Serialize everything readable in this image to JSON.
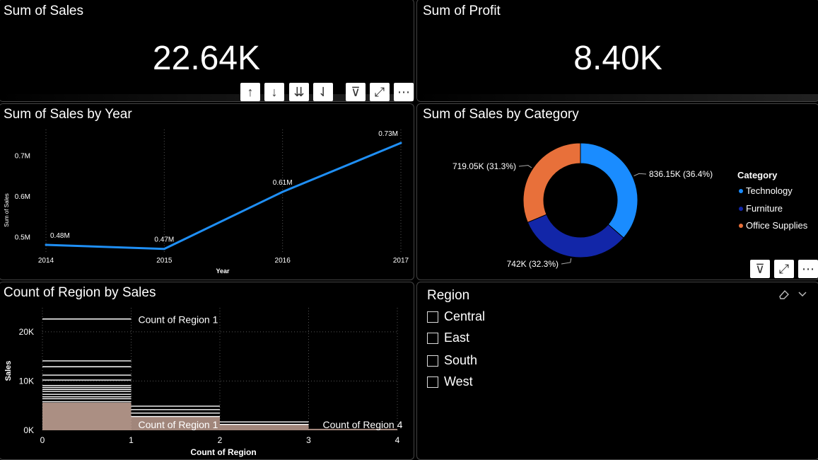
{
  "kpi_sales": {
    "title": "Sum of Sales",
    "value": "22.64K"
  },
  "kpi_profit": {
    "title": "Sum of Profit",
    "value": "8.40K"
  },
  "toolbar": {
    "sort_asc": "↑",
    "sort_desc": "↓",
    "expand_all": "⇊",
    "drill": "⇃",
    "filter": "⊽",
    "focus": "⤢",
    "more": "⋯"
  },
  "line_chart": {
    "title": "Sum of Sales by Year",
    "chart_data": {
      "type": "line",
      "x": [
        2014,
        2015,
        2016,
        2017
      ],
      "values": [
        0.48,
        0.47,
        0.61,
        0.73
      ],
      "data_labels": [
        "0.48M",
        "0.47M",
        "0.61M",
        "0.73M"
      ],
      "xlabel": "Year",
      "ylabel": "Sum of Sales",
      "y_ticks": [
        "0.5M",
        "0.6M",
        "0.7M"
      ],
      "x_ticks": [
        "2014",
        "2015",
        "2016",
        "2017"
      ],
      "line_color": "#1f8ff5"
    }
  },
  "donut_chart": {
    "title": "Sum of Sales by Category",
    "chart_data": {
      "type": "pie",
      "categories": [
        "Technology",
        "Furniture",
        "Office Supplies"
      ],
      "values": [
        836.15,
        742,
        719.05
      ],
      "data_labels": [
        "836.15K (36.4%)",
        "742K (32.3%)",
        "719.05K (31.3%)"
      ],
      "colors": [
        "#1a8cff",
        "#1226a8",
        "#e8703a"
      ],
      "legend_title": "Category",
      "legend_position": "right"
    }
  },
  "hist_chart": {
    "title": "Count of Region by Sales",
    "chart_data": {
      "type": "bar",
      "xlabel": "Count of Region",
      "ylabel": "Sales",
      "x_ticks": [
        "0",
        "1",
        "2",
        "3",
        "4"
      ],
      "y_ticks": [
        "0K",
        "10K",
        "20K"
      ],
      "annotations": [
        "Count of Region 1",
        "Count of Region 1",
        "Count of Region 4"
      ]
    }
  },
  "slicer": {
    "title": "Region",
    "items": [
      "Central",
      "East",
      "South",
      "West"
    ]
  }
}
